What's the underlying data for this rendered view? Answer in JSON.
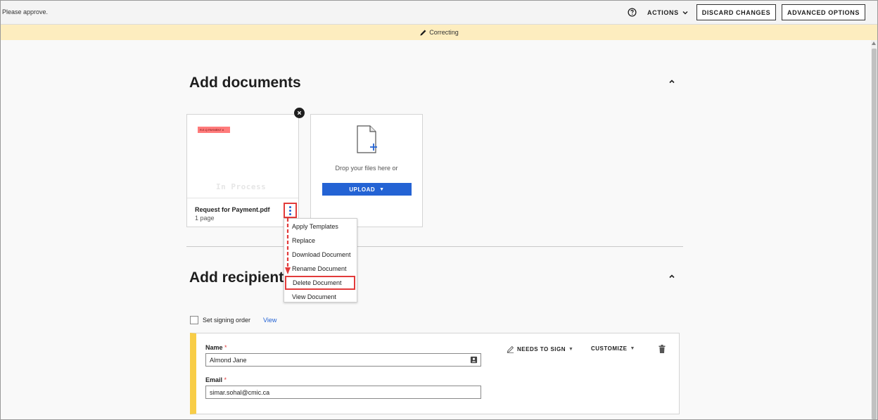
{
  "topbar": {
    "message": "Please approve.",
    "help_icon": "help-circle-icon",
    "actions_label": "ACTIONS",
    "discard_label": "DISCARD CHANGES",
    "advanced_label": "ADVANCED OPTIONS"
  },
  "banner": {
    "icon": "pencil-icon",
    "text": "Correcting"
  },
  "documents": {
    "heading": "Add documents",
    "card": {
      "name": "Request for Payment.pdf",
      "pages": "1 page",
      "watermark": "In Process",
      "tag_text": "R.E.Q PAYMENT #"
    },
    "upload": {
      "drop_text": "Drop your files here or",
      "button_label": "UPLOAD"
    },
    "menu": {
      "items": [
        {
          "label": "Apply Templates"
        },
        {
          "label": "Replace"
        },
        {
          "label": "Download Document"
        },
        {
          "label": "Rename Document"
        },
        {
          "label": "Delete Document"
        },
        {
          "label": "View Document"
        }
      ],
      "highlighted_index": 4
    }
  },
  "recipients": {
    "heading": "Add recipient",
    "signing_order_label": "Set signing order",
    "view_link": "View",
    "card": {
      "name_label": "Name",
      "name_value": "Almond Jane",
      "email_label": "Email",
      "email_value": "simar.sohal@cmic.ca",
      "required_mark": "*",
      "role_label": "NEEDS TO SIGN",
      "customize_label": "CUSTOMIZE",
      "accent_color": "#f8cd47"
    }
  },
  "colors": {
    "primary": "#2463d4",
    "highlight_red": "#e23b3b",
    "banner": "#fdedbf"
  }
}
